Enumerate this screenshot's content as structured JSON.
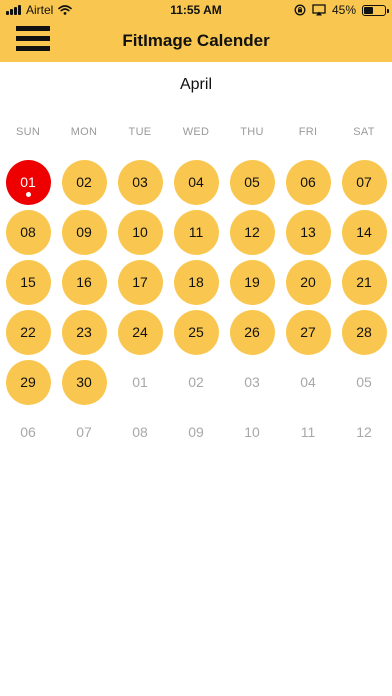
{
  "status_bar": {
    "carrier": "Airtel",
    "time": "11:55 AM",
    "battery": "45%",
    "battery_level": 0.45,
    "icons": [
      "signal-icon",
      "wifi-icon",
      "orientation-lock-icon",
      "screen-mirror-icon",
      "battery-icon"
    ]
  },
  "header": {
    "title": "FitImage Calender",
    "menu_icon": "hamburger-menu-icon",
    "background": "#f9c74f"
  },
  "calendar": {
    "month": "April",
    "weekdays": [
      "SUN",
      "MON",
      "TUE",
      "WED",
      "THU",
      "FRI",
      "SAT"
    ],
    "colors": {
      "day_fill": "#f9c74f",
      "today_fill": "#ee0000",
      "other_month_text": "#a8a8a8"
    },
    "weeks": [
      [
        {
          "label": "01",
          "state": "today"
        },
        {
          "label": "02",
          "state": "in"
        },
        {
          "label": "03",
          "state": "in"
        },
        {
          "label": "04",
          "state": "in"
        },
        {
          "label": "05",
          "state": "in"
        },
        {
          "label": "06",
          "state": "in"
        },
        {
          "label": "07",
          "state": "in"
        }
      ],
      [
        {
          "label": "08",
          "state": "in"
        },
        {
          "label": "09",
          "state": "in"
        },
        {
          "label": "10",
          "state": "in"
        },
        {
          "label": "11",
          "state": "in"
        },
        {
          "label": "12",
          "state": "in"
        },
        {
          "label": "13",
          "state": "in"
        },
        {
          "label": "14",
          "state": "in"
        }
      ],
      [
        {
          "label": "15",
          "state": "in"
        },
        {
          "label": "16",
          "state": "in"
        },
        {
          "label": "17",
          "state": "in"
        },
        {
          "label": "18",
          "state": "in"
        },
        {
          "label": "19",
          "state": "in"
        },
        {
          "label": "20",
          "state": "in"
        },
        {
          "label": "21",
          "state": "in"
        }
      ],
      [
        {
          "label": "22",
          "state": "in"
        },
        {
          "label": "23",
          "state": "in"
        },
        {
          "label": "24",
          "state": "in"
        },
        {
          "label": "25",
          "state": "in"
        },
        {
          "label": "26",
          "state": "in"
        },
        {
          "label": "27",
          "state": "in"
        },
        {
          "label": "28",
          "state": "in"
        }
      ],
      [
        {
          "label": "29",
          "state": "in"
        },
        {
          "label": "30",
          "state": "in"
        },
        {
          "label": "01",
          "state": "other"
        },
        {
          "label": "02",
          "state": "other"
        },
        {
          "label": "03",
          "state": "other"
        },
        {
          "label": "04",
          "state": "other"
        },
        {
          "label": "05",
          "state": "other"
        }
      ],
      [
        {
          "label": "06",
          "state": "other"
        },
        {
          "label": "07",
          "state": "other"
        },
        {
          "label": "08",
          "state": "other"
        },
        {
          "label": "09",
          "state": "other"
        },
        {
          "label": "10",
          "state": "other"
        },
        {
          "label": "11",
          "state": "other"
        },
        {
          "label": "12",
          "state": "other"
        }
      ]
    ]
  }
}
